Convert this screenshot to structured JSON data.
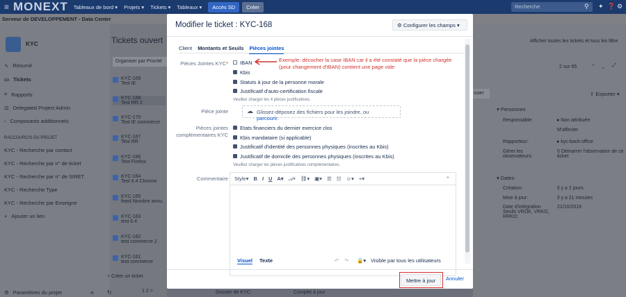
{
  "topbar": {
    "logo": "MONEXT",
    "nav": [
      "Tableaux de bord",
      "Projets",
      "Tickets",
      "Tableaux"
    ],
    "sd_button": "Accès SD",
    "create_button": "Créer",
    "search_placeholder": "Recherche"
  },
  "subbar": {
    "title": "Serveur de DEVELOPPEMENT - Data Center"
  },
  "sidebar": {
    "project": "KYC",
    "items": [
      "Résumé",
      "Tickets",
      "Rapports",
      "Delegated Project Admin",
      "Composants additionnels"
    ],
    "shortcuts_title": "RACCOURCIS DU PROJET",
    "shortcuts": [
      "KYC - Recherche par contact",
      "KYC - Recherche par n° de ticket",
      "KYC - Recherche par n° de SIRET",
      "KYC - Recherche Type",
      "KYC - Recherche par Enseigne"
    ],
    "add_link": "Ajouter un lien",
    "settings": "Paramètres du projet"
  },
  "list": {
    "title": "Tickets ouvert",
    "sort": "Organiser par Priorité",
    "tickets": [
      {
        "key": "KYC-169",
        "title": "Test IE"
      },
      {
        "key": "KYC-168",
        "title": "Test RR 2"
      },
      {
        "key": "KYC-170",
        "title": "Test IE commerce"
      },
      {
        "key": "KYC-167",
        "title": "Test RR"
      },
      {
        "key": "KYC-166",
        "title": "Test Firefox"
      },
      {
        "key": "KYC-164",
        "title": "Test 6.4 Chrome"
      },
      {
        "key": "KYC-165",
        "title": "fixed Nombre annu"
      },
      {
        "key": "KYC-163",
        "title": "test 6.4"
      },
      {
        "key": "KYC-162",
        "title": "test commerce 2"
      },
      {
        "key": "KYC-161",
        "title": "test commerce"
      }
    ],
    "create": "+ Créer un ticket",
    "page": "1 2 >"
  },
  "right": {
    "show_all": "Afficher toutes les tickets et tous les filtre",
    "count": "2 sur 65",
    "export": "Exporter",
    "partial": "ssier",
    "persons_title": "Personnes",
    "responsible_label": "Responsable:",
    "responsible_value": "Non attribuée",
    "assign_me": "M'affecter",
    "reporter_label": "Rapporteur:",
    "reporter_value": "kyc-back-office",
    "observers_label": "Gérer les observateurs:",
    "observers_count": "0",
    "observers_value": "Démarrer l'observation de ce ticket",
    "dates_title": "Dates",
    "creation_label": "Création:",
    "creation_value": "Il y a 2 jours",
    "update_label": "Mise à jour:",
    "update_value": "Il y a 21 minutes",
    "integration_label": "Date d'intégration Seuils VROK, VRKO, RRKO:",
    "integration_value": "21/10/2019"
  },
  "bottom_strip": {
    "label": "Dossier de KYC:",
    "value": "Complet à jour"
  },
  "modal": {
    "title": "Modifier le ticket : KYC-168",
    "config": "Configurer les champs",
    "tabs": [
      "Client",
      "Montants et Seuils",
      "Pièces jointes"
    ],
    "pj_kyc_label": "Pièces Jointes KYC",
    "pj_kyc_options": [
      {
        "label": "IBAN",
        "checked": false
      },
      {
        "label": "Kbis",
        "checked": true
      },
      {
        "label": "Statuts à jour de la personne morale",
        "checked": true
      },
      {
        "label": "Justificatif d'auto-certification fiscale",
        "checked": true
      }
    ],
    "pj_kyc_help": "Veuillez charger les 4 pièces justificatives.",
    "attachment_label": "Pièce jointe",
    "drop_text": "Glissez-déposez des fichiers pour les joindre, ou",
    "drop_link": "parcourir.",
    "pj_compl_label": "Pièces jointes complémentaires KYC",
    "pj_compl_options": [
      {
        "label": "Etats financiers du dernier exercice clos",
        "checked": true
      },
      {
        "label": "Kbis mandataire (si applicable)",
        "checked": true
      },
      {
        "label": "Justificatif d'identité des personnes physiques (inscrites au Kbis)",
        "checked": true
      },
      {
        "label": "Justificatif de domicile des personnes physiques (inscrites au Kbis)",
        "checked": true
      }
    ],
    "pj_compl_help": "Veuillez charger les pièces justificatives complémentaires.",
    "comment_label": "Commentaire",
    "editor_style": "Style",
    "editor_tabs": [
      "Visuel",
      "Texte"
    ],
    "visibility": "Visible par tous les utilisateurs",
    "update_button": "Mettre à jour",
    "cancel_link": "Annuler",
    "annotation": "Exemple: décocher la case IBAN car il a été constaté que la pièce chargée (pour changement d'IBAN) contient une page vide"
  },
  "colors": {
    "accent": "#0052cc",
    "annotation": "#d0312d",
    "topbar": "#1b3a6e"
  }
}
